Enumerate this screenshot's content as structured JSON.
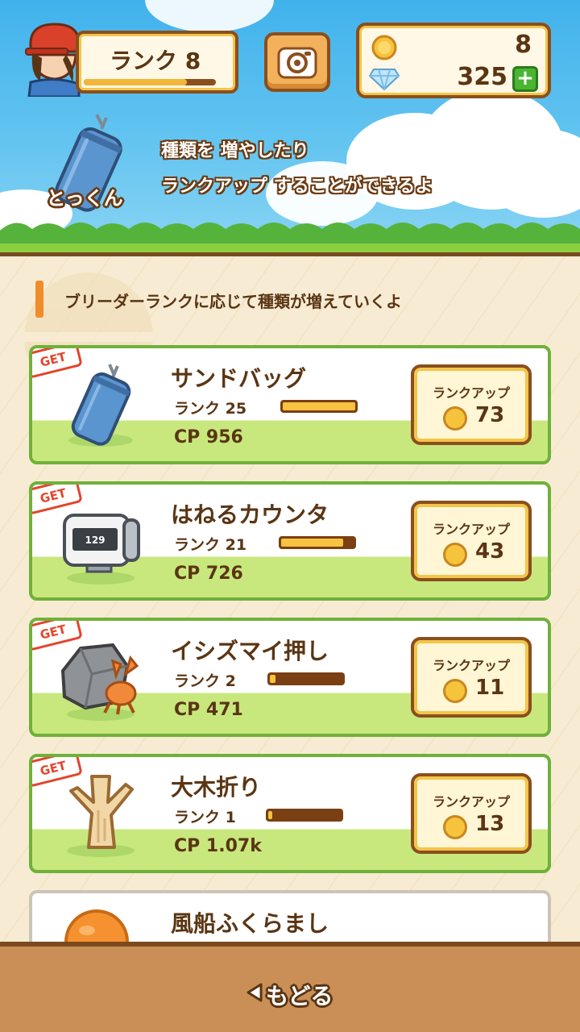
{
  "header": {
    "rank_label": "ランク 8",
    "rank_progress": 0.78,
    "coins": "8",
    "gems": "325",
    "plus_label": "+"
  },
  "banner": {
    "category_label": "とっくん",
    "message_line1": "種類を 増やしたり",
    "message_line2": "ランクアップ することができるよ"
  },
  "hint": "ブリーダーランクに応じて種類が増えていくよ",
  "items": [
    {
      "badge": "GET",
      "name": "サンドバッグ",
      "rank": "ランク 25",
      "progress": 1.0,
      "cp": "CP 956",
      "button_label": "ランクアップ",
      "cost": "73",
      "icon": "sandbag-icon"
    },
    {
      "badge": "GET",
      "name": "はねるカウンタ",
      "rank": "ランク 21",
      "progress": 0.85,
      "cp": "CP 726",
      "button_label": "ランクアップ",
      "cost": "43",
      "icon": "counter-icon",
      "counter_value": "129"
    },
    {
      "badge": "GET",
      "name": "イシズマイ押し",
      "rank": "ランク 2",
      "progress": 0.08,
      "cp": "CP 471",
      "button_label": "ランクアップ",
      "cost": "11",
      "icon": "dwebble-icon"
    },
    {
      "badge": "GET",
      "name": "大木折り",
      "rank": "ランク 1",
      "progress": 0.03,
      "cp": "CP 1.07k",
      "button_label": "ランクアップ",
      "cost": "13",
      "icon": "tree-trunk-icon"
    },
    {
      "name": "風船ふくらまし",
      "icon": "balloon-icon"
    }
  ],
  "footer": {
    "back_label": "もどる"
  },
  "colors": {
    "brown": "#5a3513",
    "accent_orange": "#f08c2a",
    "card_green": "#6fb13a",
    "get_red": "#e2452c"
  }
}
